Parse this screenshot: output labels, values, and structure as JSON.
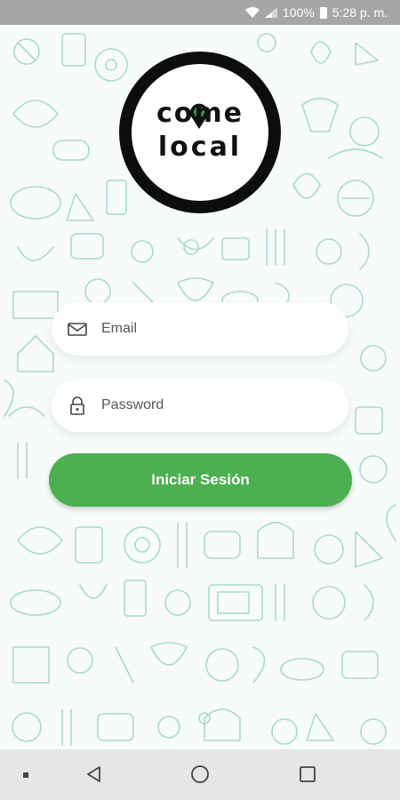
{
  "status_bar": {
    "battery_percent": "100%",
    "time": "5:28 p. m.",
    "icons": [
      "wifi-icon",
      "signal-icon",
      "battery-icon"
    ]
  },
  "logo": {
    "line1": "come",
    "line2": "local",
    "icons": [
      "location-pin-icon",
      "fork-icon"
    ]
  },
  "form": {
    "email_placeholder": "Email",
    "email_value": "",
    "email_icon": "mail-icon",
    "password_placeholder": "Password",
    "password_value": "",
    "password_icon": "lock-icon",
    "submit_label": "Iniciar Sesión"
  },
  "colors": {
    "accent": "#4caf50",
    "pattern": "#a8dcc4",
    "logo_ring": "#0d0d0d",
    "pin_green": "#2e9e44"
  },
  "nav_bar": {
    "icons": [
      "back-icon",
      "home-icon",
      "recent-apps-icon"
    ]
  }
}
